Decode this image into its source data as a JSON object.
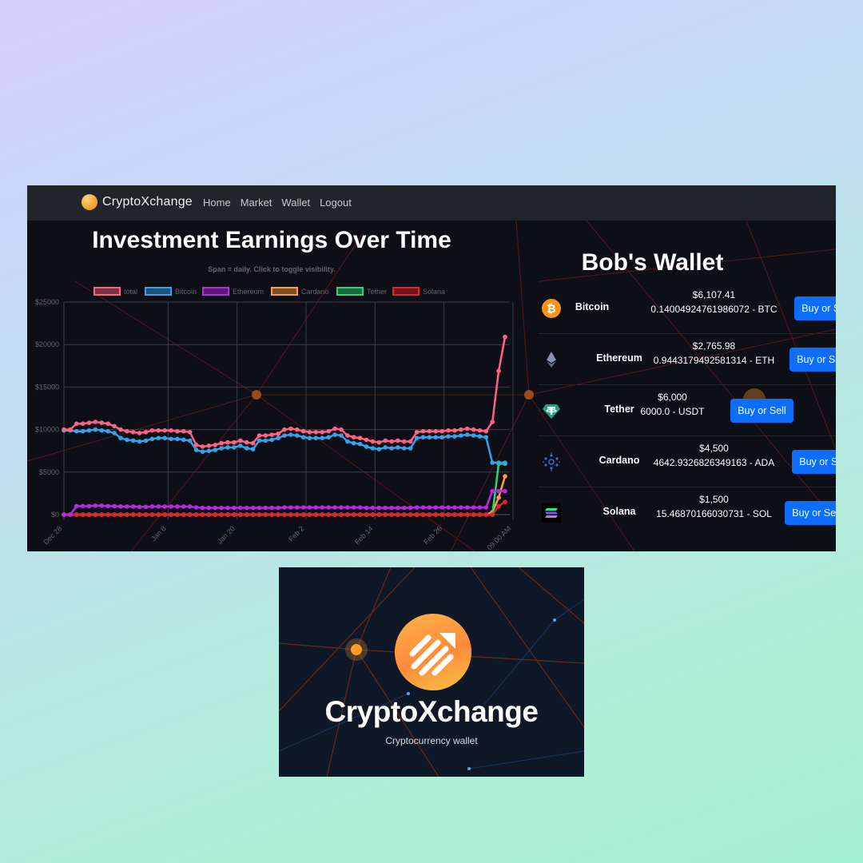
{
  "navbar": {
    "brand": "CryptoXchange",
    "links": [
      "Home",
      "Market",
      "Wallet",
      "Logout"
    ]
  },
  "chart_section": {
    "title": "Investment Earnings Over Time",
    "subtitle": "Span = daily. Click to toggle visibility."
  },
  "chart_data": {
    "type": "line",
    "y_ticks": [
      "$0",
      "$5000",
      "$10000",
      "$15000",
      "$20000",
      "$25000"
    ],
    "ylim": [
      0,
      25000
    ],
    "x_labels": [
      "Dec 28",
      "Jan 8",
      "Jan 20",
      "Feb 2",
      "Feb 14",
      "Feb 26",
      "09:00 AM"
    ],
    "legend_position": "top",
    "grid": true,
    "series": [
      {
        "name": "total",
        "color": "#ff6384",
        "values": [
          10000,
          10000,
          10700,
          10700,
          10800,
          10900,
          10800,
          10700,
          10400,
          10000,
          9800,
          9700,
          9600,
          9700,
          9900,
          9900,
          9900,
          9900,
          9800,
          9800,
          9700,
          8200,
          8000,
          8100,
          8200,
          8400,
          8500,
          8500,
          8700,
          8500,
          8400,
          9300,
          9300,
          9400,
          9500,
          10000,
          10100,
          10000,
          9800,
          9700,
          9700,
          9700,
          9800,
          10100,
          10000,
          9300,
          9100,
          9000,
          8800,
          8600,
          8500,
          8700,
          8600,
          8700,
          8600,
          8600,
          9700,
          9800,
          9800,
          9800,
          9800,
          9900,
          9900,
          10000,
          10100,
          10000,
          9900,
          9800,
          10900,
          16900,
          20900
        ]
      },
      {
        "name": "Bitcoin",
        "color": "#36a2eb",
        "values": [
          9900,
          9900,
          9800,
          9800,
          9900,
          10000,
          9900,
          9800,
          9600,
          9000,
          8800,
          8700,
          8600,
          8700,
          8900,
          9000,
          9000,
          8900,
          8900,
          8800,
          8700,
          7600,
          7400,
          7500,
          7600,
          7800,
          7900,
          7900,
          8100,
          7800,
          7700,
          8700,
          8700,
          8800,
          9000,
          9300,
          9400,
          9300,
          9100,
          9000,
          9000,
          9000,
          9100,
          9400,
          9300,
          8600,
          8400,
          8300,
          8000,
          7800,
          7700,
          7900,
          7800,
          7900,
          7800,
          7800,
          9000,
          9100,
          9100,
          9100,
          9100,
          9200,
          9200,
          9300,
          9400,
          9300,
          9200,
          9100,
          6107,
          6107,
          6107
        ]
      },
      {
        "name": "Ethereum",
        "color": "#b62be2",
        "values": [
          0,
          0,
          1000,
          1000,
          1000,
          1050,
          1050,
          1000,
          1000,
          950,
          950,
          950,
          900,
          900,
          950,
          950,
          950,
          950,
          950,
          950,
          950,
          850,
          800,
          800,
          800,
          800,
          800,
          800,
          800,
          800,
          800,
          800,
          800,
          800,
          800,
          850,
          850,
          850,
          850,
          850,
          850,
          850,
          850,
          850,
          850,
          850,
          850,
          850,
          800,
          800,
          800,
          800,
          800,
          800,
          800,
          800,
          850,
          850,
          850,
          850,
          850,
          850,
          850,
          850,
          850,
          850,
          850,
          850,
          2766,
          2766,
          2766
        ]
      },
      {
        "name": "Cardano",
        "color": "#ff9f40",
        "values": [
          0,
          0,
          0,
          0,
          0,
          0,
          0,
          0,
          0,
          0,
          0,
          0,
          0,
          0,
          0,
          0,
          0,
          0,
          0,
          0,
          0,
          0,
          0,
          0,
          0,
          0,
          0,
          0,
          0,
          0,
          0,
          0,
          0,
          0,
          0,
          0,
          0,
          0,
          0,
          0,
          0,
          0,
          0,
          0,
          0,
          0,
          0,
          0,
          0,
          0,
          0,
          0,
          0,
          0,
          0,
          0,
          0,
          0,
          0,
          0,
          0,
          0,
          0,
          0,
          0,
          0,
          0,
          0,
          300,
          2000,
          4500
        ]
      },
      {
        "name": "Tether",
        "color": "#2ed573",
        "values": [
          0,
          0,
          0,
          0,
          0,
          0,
          0,
          0,
          0,
          0,
          0,
          0,
          0,
          0,
          0,
          0,
          0,
          0,
          0,
          0,
          0,
          0,
          0,
          0,
          0,
          0,
          0,
          0,
          0,
          0,
          0,
          0,
          0,
          0,
          0,
          0,
          0,
          0,
          0,
          0,
          0,
          0,
          0,
          0,
          0,
          0,
          0,
          0,
          0,
          0,
          0,
          0,
          0,
          0,
          0,
          0,
          0,
          0,
          0,
          0,
          0,
          0,
          0,
          0,
          0,
          0,
          0,
          0,
          0,
          6000,
          6000
        ]
      },
      {
        "name": "Solana",
        "color": "#e8212f",
        "values": [
          0,
          0,
          0,
          0,
          0,
          0,
          0,
          0,
          0,
          0,
          0,
          0,
          0,
          0,
          0,
          0,
          0,
          0,
          0,
          0,
          0,
          0,
          0,
          0,
          0,
          0,
          0,
          0,
          0,
          0,
          0,
          0,
          0,
          0,
          0,
          0,
          0,
          0,
          0,
          0,
          0,
          0,
          0,
          0,
          0,
          0,
          0,
          0,
          0,
          0,
          0,
          0,
          0,
          0,
          0,
          0,
          0,
          0,
          0,
          0,
          0,
          0,
          0,
          0,
          0,
          0,
          0,
          0,
          0,
          1000,
          1500
        ]
      }
    ]
  },
  "wallet": {
    "title": "Bob's Wallet",
    "button_label": "Buy or Sell",
    "coins": [
      {
        "name": "Bitcoin",
        "value": "$6,107.41",
        "amount": "0.14004924761986072 - BTC",
        "icon": "bitcoin-icon"
      },
      {
        "name": "Ethereum",
        "value": "$2,765.98",
        "amount": "0.9443179492581314 - ETH",
        "icon": "ethereum-icon"
      },
      {
        "name": "Tether",
        "value": "$6,000",
        "amount": "6000.0 - USDT",
        "icon": "tether-icon"
      },
      {
        "name": "Cardano",
        "value": "$4,500",
        "amount": "4642.9326826349163 - ADA",
        "icon": "cardano-icon"
      },
      {
        "name": "Solana",
        "value": "$1,500",
        "amount": "15.46870166030731 - SOL",
        "icon": "solana-icon"
      }
    ]
  },
  "promo": {
    "title": "CryptoXchange",
    "subtitle": "Cryptocurrency wallet"
  },
  "colors": {
    "navbar_bg": "#212529",
    "app_bg": "#0d0e16",
    "button": "#0d6efd",
    "brand_orange": "#f39a2a"
  }
}
